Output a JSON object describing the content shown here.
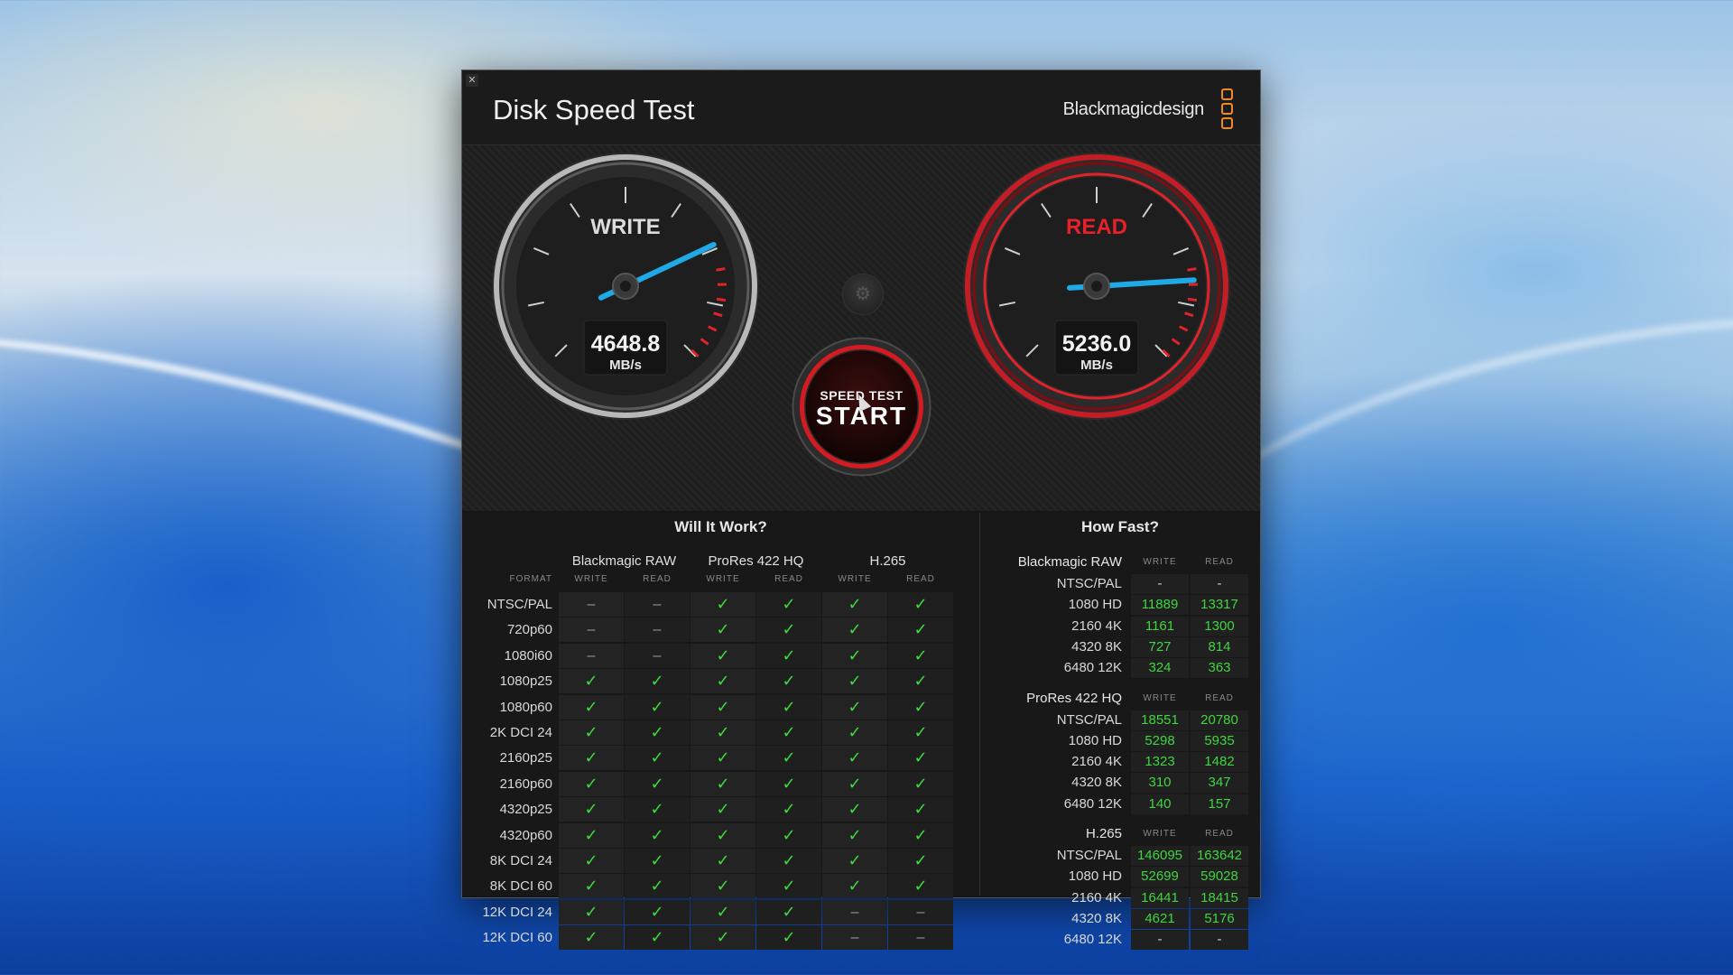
{
  "app": {
    "title": "Disk Speed Test",
    "brand": "Blackmagicdesign",
    "close_label": "✕"
  },
  "gauges": {
    "write": {
      "label": "WRITE",
      "value": "4648.8",
      "unit": "MB/s",
      "needle_fraction": 0.74,
      "accent": "#e0e0e0"
    },
    "read": {
      "label": "READ",
      "value": "5236.0",
      "unit": "MB/s",
      "needle_fraction": 0.82,
      "accent": "#e8202a"
    }
  },
  "start_button": {
    "small_label": "SPEED TEST",
    "big_label": "START"
  },
  "will_it_work": {
    "title": "Will It Work?",
    "format_header": "FORMAT",
    "codecs": [
      "Blackmagic RAW",
      "ProRes 422 HQ",
      "H.265"
    ],
    "sub_headers": [
      "WRITE",
      "READ",
      "WRITE",
      "READ",
      "WRITE",
      "READ"
    ],
    "rows": [
      {
        "format": "NTSC/PAL",
        "cells": [
          "-",
          "-",
          "y",
          "y",
          "y",
          "y"
        ]
      },
      {
        "format": "720p60",
        "cells": [
          "-",
          "-",
          "y",
          "y",
          "y",
          "y"
        ]
      },
      {
        "format": "1080i60",
        "cells": [
          "-",
          "-",
          "y",
          "y",
          "y",
          "y"
        ]
      },
      {
        "format": "1080p25",
        "cells": [
          "y",
          "y",
          "y",
          "y",
          "y",
          "y"
        ]
      },
      {
        "format": "1080p60",
        "cells": [
          "y",
          "y",
          "y",
          "y",
          "y",
          "y"
        ]
      },
      {
        "format": "2K DCI 24",
        "cells": [
          "y",
          "y",
          "y",
          "y",
          "y",
          "y"
        ]
      },
      {
        "format": "2160p25",
        "cells": [
          "y",
          "y",
          "y",
          "y",
          "y",
          "y"
        ]
      },
      {
        "format": "2160p60",
        "cells": [
          "y",
          "y",
          "y",
          "y",
          "y",
          "y"
        ]
      },
      {
        "format": "4320p25",
        "cells": [
          "y",
          "y",
          "y",
          "y",
          "y",
          "y"
        ]
      },
      {
        "format": "4320p60",
        "cells": [
          "y",
          "y",
          "y",
          "y",
          "y",
          "y"
        ]
      },
      {
        "format": "8K DCI 24",
        "cells": [
          "y",
          "y",
          "y",
          "y",
          "y",
          "y"
        ]
      },
      {
        "format": "8K DCI 60",
        "cells": [
          "y",
          "y",
          "y",
          "y",
          "y",
          "y"
        ]
      },
      {
        "format": "12K DCI 24",
        "cells": [
          "y",
          "y",
          "y",
          "y",
          "-",
          "-"
        ]
      },
      {
        "format": "12K DCI 60",
        "cells": [
          "y",
          "y",
          "y",
          "y",
          "-",
          "-"
        ]
      }
    ],
    "check_glyph": "✓",
    "dash_glyph": "–"
  },
  "how_fast": {
    "title": "How Fast?",
    "write_header": "WRITE",
    "read_header": "READ",
    "groups": [
      {
        "codec": "Blackmagic RAW",
        "rows": [
          {
            "label": "NTSC/PAL",
            "write": "-",
            "read": "-"
          },
          {
            "label": "1080 HD",
            "write": "11889",
            "read": "13317"
          },
          {
            "label": "2160 4K",
            "write": "1161",
            "read": "1300"
          },
          {
            "label": "4320 8K",
            "write": "727",
            "read": "814"
          },
          {
            "label": "6480 12K",
            "write": "324",
            "read": "363"
          }
        ]
      },
      {
        "codec": "ProRes 422 HQ",
        "rows": [
          {
            "label": "NTSC/PAL",
            "write": "18551",
            "read": "20780"
          },
          {
            "label": "1080 HD",
            "write": "5298",
            "read": "5935"
          },
          {
            "label": "2160 4K",
            "write": "1323",
            "read": "1482"
          },
          {
            "label": "4320 8K",
            "write": "310",
            "read": "347"
          },
          {
            "label": "6480 12K",
            "write": "140",
            "read": "157"
          }
        ]
      },
      {
        "codec": "H.265",
        "rows": [
          {
            "label": "NTSC/PAL",
            "write": "146095",
            "read": "163642"
          },
          {
            "label": "1080 HD",
            "write": "52699",
            "read": "59028"
          },
          {
            "label": "2160 4K",
            "write": "16441",
            "read": "18415"
          },
          {
            "label": "4320 8K",
            "write": "4621",
            "read": "5176"
          },
          {
            "label": "6480 12K",
            "write": "-",
            "read": "-"
          }
        ]
      }
    ]
  },
  "colors": {
    "ok": "#3ddc3d",
    "value": "#41d441",
    "needle": "#1fa9e6",
    "red": "#e8202a"
  }
}
